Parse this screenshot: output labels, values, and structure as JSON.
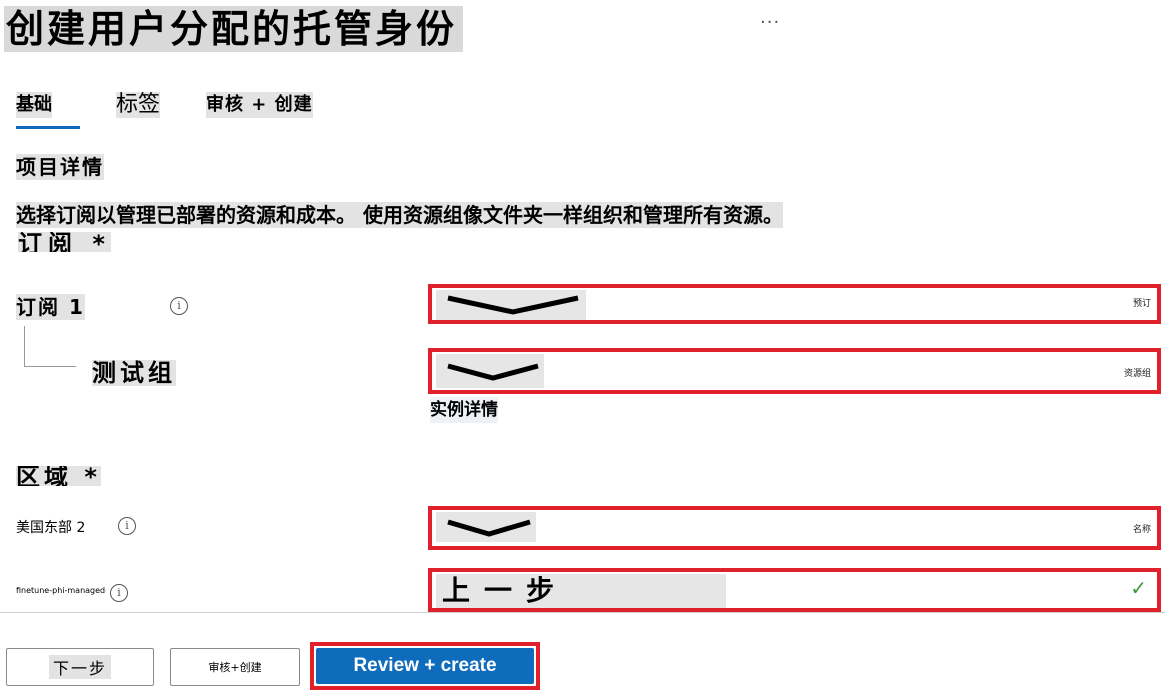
{
  "page": {
    "title": "创建用户分配的托管身份",
    "more_label": "···"
  },
  "tabs": [
    {
      "label": "基础",
      "active": true
    },
    {
      "label": "标签",
      "active": false
    },
    {
      "label": "审核 + 创建",
      "active": false
    }
  ],
  "project": {
    "heading": "项目详情",
    "description": "选择订阅以管理已部署的资源和成本。 使用资源组像文件夹一样组织和管理所有资源。",
    "subscription_heading": "订阅 *",
    "subscription_label": "订阅 1",
    "subscription_value": "预订",
    "resource_group_label": "测试组",
    "resource_group_value": "资源组",
    "instance_heading": "实例详情"
  },
  "instance": {
    "region_heading": "区域 *",
    "region_label": "美国东部 2",
    "region_value": "名称",
    "name_label": "finetune-phi-managed-identity",
    "name_value": "上一步"
  },
  "footer": {
    "next_label": "下一步",
    "review_cn_label": "审核+创建",
    "review_create_label": "Review + create"
  },
  "colors": {
    "accent": "#0f6cbd",
    "highlight_border": "#e0202a",
    "valid_check": "#3a9a3a"
  }
}
